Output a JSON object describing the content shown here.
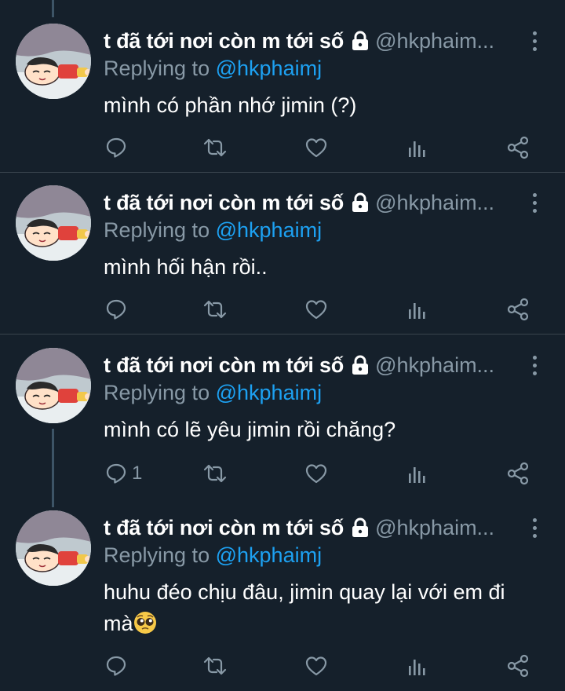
{
  "tweets": [
    {
      "name": "t đã tới nơi còn m tới số",
      "handle": "@hkphaim...",
      "replying_prefix": "Replying to",
      "replying_to": "@hkphaimj",
      "text": "mình có phần nhớ jimin (?)",
      "reply_count": ""
    },
    {
      "name": "t đã tới nơi còn m tới số",
      "handle": "@hkphaim...",
      "replying_prefix": "Replying to",
      "replying_to": "@hkphaimj",
      "text": "mình hối hận rồi..",
      "reply_count": ""
    },
    {
      "name": "t đã tới nơi còn m tới số",
      "handle": "@hkphaim...",
      "replying_prefix": "Replying to",
      "replying_to": "@hkphaimj",
      "text": "mình có lẽ yêu jimin rồi chăng?",
      "reply_count": "1"
    },
    {
      "name": "t đã tới nơi còn m tới số",
      "handle": "@hkphaim...",
      "replying_prefix": "Replying to",
      "replying_to": "@hkphaimj",
      "text": "huhu đéo chịu đâu, jimin quay lại với em đi mà",
      "reply_count": ""
    }
  ],
  "icons": {
    "reply": "reply-icon",
    "retweet": "retweet-icon",
    "like": "heart-icon",
    "analytics": "analytics-icon",
    "share": "share-icon",
    "lock": "lock-icon",
    "more": "more-options-icon",
    "emoji": "pleading-face-emoji"
  },
  "colors": {
    "background": "#15202b",
    "text": "#ffffff",
    "secondary": "#8899a6",
    "accent": "#1da1f2",
    "divider": "#38444d"
  }
}
